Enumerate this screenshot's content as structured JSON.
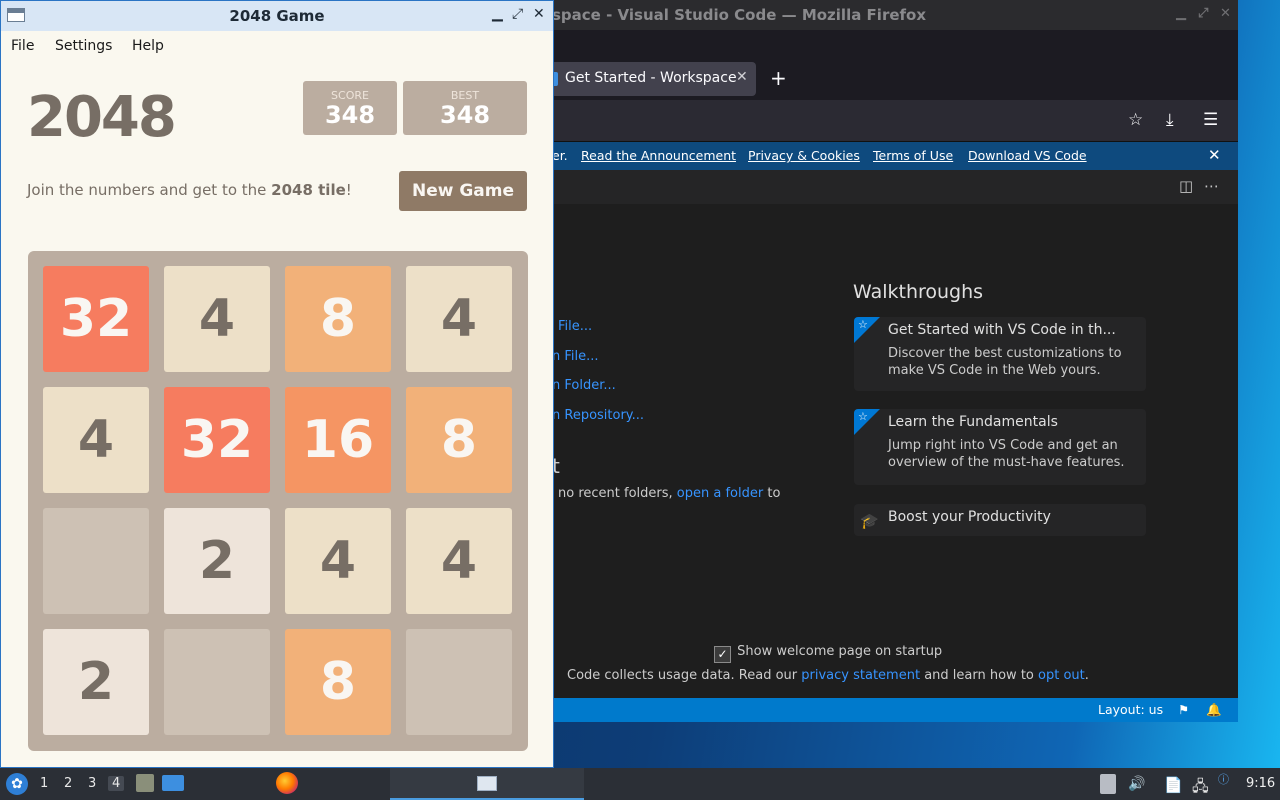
{
  "firefox": {
    "window_title": "space - Visual Studio Code — Mozilla Firefox",
    "tab_label": "Get Started - Workspace",
    "tab_close": "✕",
    "new_tab": "+",
    "banner": {
      "partial": "er.",
      "announcement": "Read the Announcement",
      "privacy": "Privacy & Cookies",
      "terms": "Terms of Use",
      "download": "Download VS Code",
      "close": "✕"
    }
  },
  "vscode": {
    "start_links": [
      "File...",
      "n File...",
      "n Folder...",
      "n Repository..."
    ],
    "recent_heading": "t",
    "recent_text_before": "no recent folders,",
    "recent_link": "open a folder",
    "recent_text_after": "to",
    "walkthroughs_title": "Walkthroughs",
    "cards": [
      {
        "title": "Get Started with VS Code in th...",
        "desc": "Discover the best customizations to make VS Code in the Web yours."
      },
      {
        "title": "Learn the Fundamentals",
        "desc": "Jump right into VS Code and get an overview of the must-have features."
      },
      {
        "title": "Boost your Productivity",
        "desc": ""
      }
    ],
    "show_welcome_label": "Show welcome page on startup",
    "show_welcome_checked": true,
    "usage_before": "Code collects usage data. Read our",
    "usage_privacy_link": "privacy statement",
    "usage_middle": "and learn how to",
    "usage_optout_link": "opt out",
    "usage_after": ".",
    "status_layout": "Layout: us"
  },
  "game": {
    "window_title": "2048 Game",
    "menu": [
      "File",
      "Settings",
      "Help"
    ],
    "logo": "2048",
    "score_label": "SCORE",
    "score_value": "348",
    "best_label": "BEST",
    "best_value": "348",
    "intro_before": "Join the numbers and get to the ",
    "intro_bold": "2048 tile",
    "intro_after": "!",
    "new_game_label": "New Game",
    "board": [
      [
        32,
        4,
        8,
        4
      ],
      [
        4,
        32,
        16,
        8
      ],
      [
        0,
        2,
        4,
        4
      ],
      [
        2,
        0,
        8,
        0
      ]
    ]
  },
  "taskbar": {
    "workspaces": [
      "1",
      "2",
      "3",
      "4"
    ],
    "active_workspace": "4",
    "clock": "9:16"
  },
  "colors": {
    "tile_empty": "#cdc1b4",
    "tile_2": "#eee4da",
    "tile_4": "#ede0c8",
    "tile_8": "#f2b179",
    "tile_16": "#f59563",
    "tile_32": "#f67c5f",
    "tile_dark_text": "#776e65",
    "tile_light_text": "#f9f6f2",
    "vscode_accent": "#007acc",
    "link": "#3794ff"
  }
}
